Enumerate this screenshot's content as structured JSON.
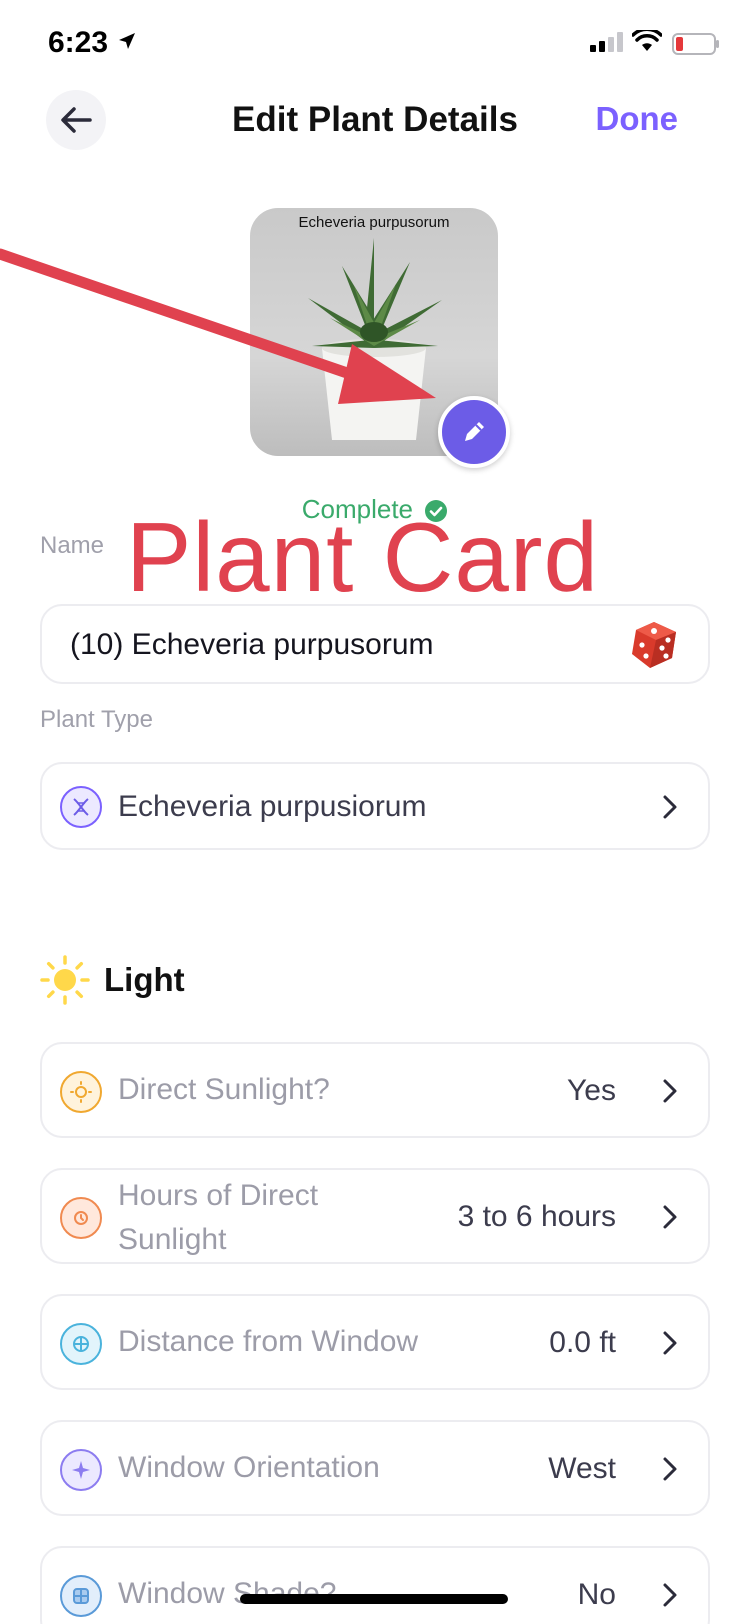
{
  "status_bar": {
    "time": "6:23"
  },
  "header": {
    "title": "Edit Plant Details",
    "done_label": "Done"
  },
  "photo": {
    "caption": "Echeveria purpusorum"
  },
  "status": {
    "complete_label": "Complete"
  },
  "annotation": {
    "overlay_text": "Plant Card"
  },
  "name_field": {
    "label": "Name",
    "value": "(10) Echeveria purpusorum"
  },
  "plant_type": {
    "label": "Plant Type",
    "value": "Echeveria purpusiorum"
  },
  "light_section": {
    "title": "Light",
    "rows": [
      {
        "label": "Direct Sunlight?",
        "value": "Yes",
        "icon": "sun-circle-icon"
      },
      {
        "label": "Hours of Direct Sunlight",
        "label_line1": "Hours of Direct",
        "label_line2": "Sunlight",
        "value": "3 to 6 hours",
        "icon": "sun-clock-icon"
      },
      {
        "label": "Distance from Window",
        "value": "0.0 ft",
        "icon": "window-icon"
      },
      {
        "label": "Window Orientation",
        "value": "West",
        "icon": "compass-icon"
      },
      {
        "label": "Window Shade?",
        "value": "No",
        "icon": "window-shade-icon"
      }
    ]
  },
  "colors": {
    "accent": "#7b61ff",
    "success": "#3aaa6b",
    "annotation": "#e0424f"
  }
}
